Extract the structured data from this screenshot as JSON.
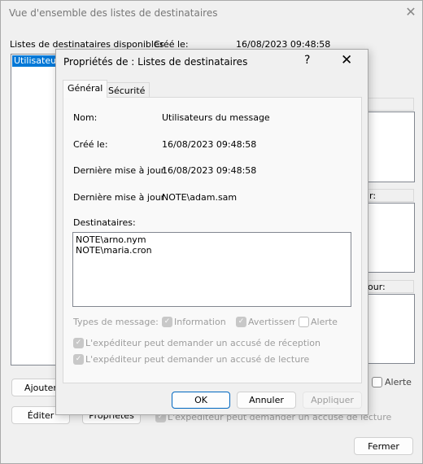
{
  "back_window": {
    "title": "Vue d'ensemble des listes de destinataires",
    "lists_label": "Listes de destinataires disponibles",
    "created_label": "Créé le:",
    "created_value": "16/08/2023 09:48:58",
    "list_items": [
      "Utilisateurs"
    ],
    "partial_label_1": "r:",
    "partial_label_2": "our:",
    "alert_label": "Alerte",
    "partial_checkbox_text": "L'expéditeur peut demander un accusé de lecture",
    "buttons": {
      "add": "Ajouter",
      "edit": "Éditer",
      "properties": "Propriétés",
      "close": "Fermer"
    }
  },
  "dialog": {
    "title": "Propriétés de : Listes de destinataires",
    "help": "?",
    "tabs": [
      {
        "label": "Général",
        "active": true
      },
      {
        "label": "Sécurité",
        "active": false
      }
    ],
    "fields": {
      "name_label": "Nom:",
      "name_value": "Utilisateurs du message",
      "created_label": "Créé le:",
      "created_value": "16/08/2023 09:48:58",
      "updated_label": "Dernière mise à jour",
      "updated_value": "16/08/2023 09:48:58",
      "updated_by_label": "Dernière mise à jour",
      "updated_by_value": "NOTE\\adam.sam"
    },
    "recipients_label": "Destinataires:",
    "recipients": [
      "NOTE\\arno.nym",
      "NOTE\\maria.cron"
    ],
    "message_types_label": "Types de message:",
    "message_types": [
      {
        "label": "Information",
        "checked": true
      },
      {
        "label": "Avertissem",
        "checked": true
      },
      {
        "label": "Alerte",
        "checked": false
      }
    ],
    "options": [
      {
        "label": "L'expéditeur peut demander un accusé de réception",
        "checked": true
      },
      {
        "label": "L'expéditeur peut demander un accusé de lecture",
        "checked": true
      }
    ],
    "buttons": {
      "ok": "OK",
      "cancel": "Annuler",
      "apply": "Appliquer"
    }
  }
}
